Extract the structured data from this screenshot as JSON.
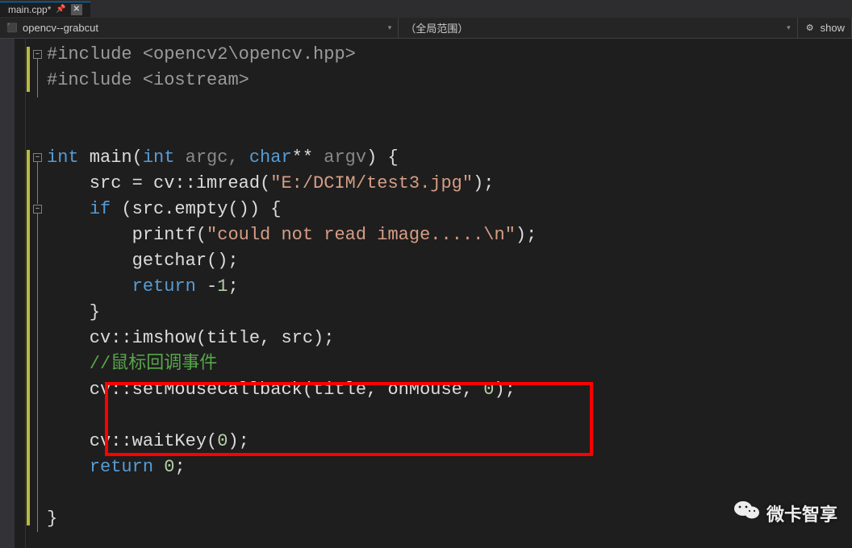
{
  "tab": {
    "title": "main.cpp*",
    "pin_glyph": "📌",
    "close_glyph": "✕"
  },
  "nav": {
    "project_icon": "⬛",
    "project": "opencv--grabcut",
    "scope": "（全局范围）",
    "member_icon": "⚙",
    "member": "show",
    "arrow": "▾"
  },
  "code": {
    "lines": [
      {
        "t": "preproc",
        "text": "#include <opencv2\\opencv.hpp>"
      },
      {
        "t": "preproc",
        "text": "#include <iostream>"
      },
      {
        "t": "blank",
        "text": ""
      },
      {
        "t": "blank",
        "text": ""
      },
      {
        "t": "main_sig",
        "kw1": "int",
        "name": " main(",
        "kw2": "int",
        "arg1": " argc, ",
        "kw3": "char",
        "stars": "** ",
        "arg2": "argv",
        "close": ") {"
      },
      {
        "t": "stmt",
        "text": "    src = cv::imread(",
        "str": "\"E:/DCIM/test3.jpg\"",
        "tail": ");"
      },
      {
        "t": "if",
        "kw": "if",
        "text": " (src.empty()) {"
      },
      {
        "t": "stmt",
        "text": "        printf(",
        "str": "\"could not read image.....\\n\"",
        "tail": ");"
      },
      {
        "t": "stmt",
        "text": "        getchar();"
      },
      {
        "t": "ret",
        "kw": "return",
        "text": " -",
        "num": "1",
        "tail": ";"
      },
      {
        "t": "stmt",
        "text": "    }"
      },
      {
        "t": "stmt",
        "text": "    cv::imshow(title, src);"
      },
      {
        "t": "comment",
        "text": "    //鼠标回调事件"
      },
      {
        "t": "stmt",
        "text": "    cv::setMouseCallback(title, onMouse, ",
        "num": "0",
        "tail": ");"
      },
      {
        "t": "blank",
        "text": ""
      },
      {
        "t": "stmt",
        "text": "    cv::waitKey(",
        "num": "0",
        "tail": ");"
      },
      {
        "t": "ret",
        "kw": "return",
        "text": " ",
        "num": "0",
        "tail": ";"
      },
      {
        "t": "blank",
        "text": ""
      },
      {
        "t": "stmt",
        "text": "}"
      }
    ]
  },
  "watermark": {
    "text": "微卡智享"
  }
}
